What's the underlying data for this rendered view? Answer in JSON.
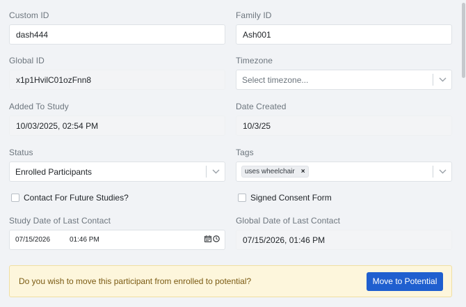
{
  "form": {
    "custom_id": {
      "label": "Custom ID",
      "value": "dash444"
    },
    "family_id": {
      "label": "Family ID",
      "value": "Ash001"
    },
    "global_id": {
      "label": "Global ID",
      "value": "x1p1HvilC01ozFnn8"
    },
    "timezone": {
      "label": "Timezone",
      "placeholder": "Select timezone..."
    },
    "added_to_study": {
      "label": "Added To Study",
      "value": "10/03/2025, 02:54 PM"
    },
    "date_created": {
      "label": "Date Created",
      "value": "10/3/25"
    },
    "status": {
      "label": "Status",
      "value": "Enrolled Participants"
    },
    "tags": {
      "label": "Tags",
      "items": [
        "uses wheelchair"
      ],
      "remove_glyph": "×"
    },
    "contact_future": {
      "label": "Contact For Future Studies?",
      "checked": false
    },
    "signed_consent": {
      "label": "Signed Consent Form",
      "checked": false
    },
    "study_last_contact": {
      "label": "Study Date of Last Contact",
      "date": "07/15/2026",
      "time": "01:46 PM"
    },
    "global_last_contact": {
      "label": "Global Date of Last Contact",
      "value": "07/15/2026, 01:46 PM"
    }
  },
  "banner": {
    "message": "Do you wish to move this participant from enrolled to potential?",
    "button_label": "Move to Potential"
  },
  "colors": {
    "background": "#f1f3f6",
    "primary_button": "#1f5fcf",
    "banner_bg": "#fdf6dc",
    "banner_text": "#7a5a12"
  }
}
